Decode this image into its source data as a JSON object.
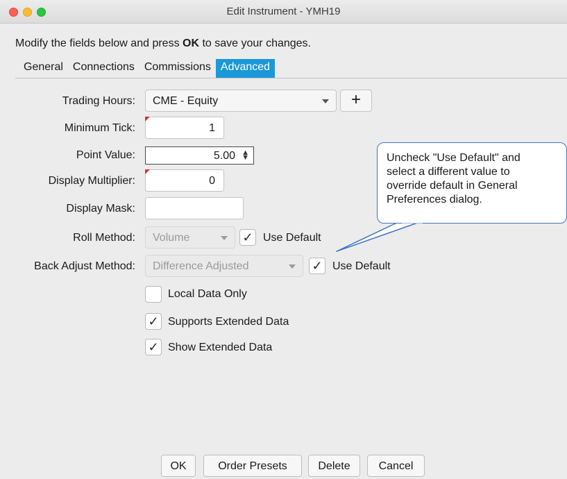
{
  "window": {
    "title": "Edit Instrument - YMH19"
  },
  "instructions": {
    "before": "Modify the fields below and press ",
    "bold": "OK",
    "after": " to save your changes."
  },
  "tabs": [
    {
      "label": "General",
      "active": false
    },
    {
      "label": "Connections",
      "active": false
    },
    {
      "label": "Commissions",
      "active": false
    },
    {
      "label": "Advanced",
      "active": true
    }
  ],
  "form": {
    "trading_hours": {
      "label": "Trading Hours:",
      "value": "CME - Equity",
      "add_label": "+"
    },
    "minimum_tick": {
      "label": "Minimum Tick:",
      "value": "1"
    },
    "point_value": {
      "label": "Point Value:",
      "value": "5.00"
    },
    "display_multiplier": {
      "label": "Display Multiplier:",
      "value": "0"
    },
    "display_mask": {
      "label": "Display Mask:",
      "value": ""
    },
    "roll_method": {
      "label": "Roll Method:",
      "value": "Volume",
      "use_default_label": "Use Default",
      "use_default_checked": true
    },
    "back_adjust_method": {
      "label": "Back Adjust Method:",
      "value": "Difference Adjusted",
      "use_default_label": "Use Default",
      "use_default_checked": true
    },
    "local_data_only": {
      "label": "Local Data Only",
      "checked": false
    },
    "supports_extended_data": {
      "label": "Supports Extended Data",
      "checked": true
    },
    "show_extended_data": {
      "label": "Show Extended Data",
      "checked": true
    }
  },
  "callout": {
    "text_lines": [
      "Uncheck \"Use Default\" and",
      "select a different value to",
      "override default in General",
      "Preferences dialog."
    ]
  },
  "buttons": {
    "ok": "OK",
    "order_presets": "Order Presets",
    "delete": "Delete",
    "cancel": "Cancel"
  },
  "colors": {
    "accent": "#1a98d8",
    "callout_border": "#4472c4",
    "flag": "#e52d2d"
  },
  "checkmark": "✓"
}
